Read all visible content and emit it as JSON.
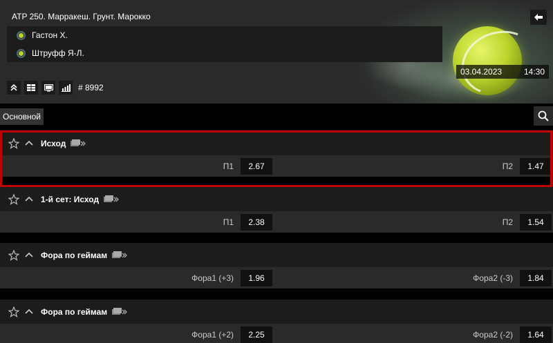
{
  "header": {
    "title": "ATP 250. Марракеш. Грунт. Марокко",
    "back_icon": "back-arrow-icon",
    "players": [
      {
        "name": "Гастон Х."
      },
      {
        "name": "Штруфф Я-Л."
      }
    ],
    "date": "03.04.2023",
    "time": "14:30",
    "toolbar_icons": [
      "collapse-icon",
      "grid-icon",
      "monitor-icon",
      "stats-icon"
    ],
    "match_id": "# 8992"
  },
  "tabs": {
    "main_label": "Основной",
    "search_icon": "search-icon"
  },
  "markets": [
    {
      "title": "Исход",
      "odds": [
        {
          "label": "П1",
          "value": "2.67"
        },
        {
          "label": "П2",
          "value": "1.47"
        }
      ]
    },
    {
      "title": "1-й сет: Исход",
      "odds": [
        {
          "label": "П1",
          "value": "2.38"
        },
        {
          "label": "П2",
          "value": "1.54"
        }
      ]
    },
    {
      "title": "Фора по геймам",
      "odds": [
        {
          "label": "Фора1 (+3)",
          "value": "1.96"
        },
        {
          "label": "Фора2 (-3)",
          "value": "1.84"
        }
      ]
    },
    {
      "title": "Фора по геймам",
      "odds": [
        {
          "label": "Фора1 (+2)",
          "value": "2.25"
        },
        {
          "label": "Фора2 (-2)",
          "value": "1.64"
        }
      ]
    }
  ],
  "colors": {
    "accent_highlight": "#c00000",
    "ball": "#bcd42c"
  }
}
